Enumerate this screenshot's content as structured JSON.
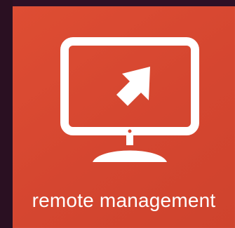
{
  "tile": {
    "label": "remote management",
    "icon": "remote-desktop-icon",
    "background_color": "#d84a31",
    "foreground_color": "#ffffff"
  },
  "backdrop": {
    "color": "#2b1225"
  }
}
